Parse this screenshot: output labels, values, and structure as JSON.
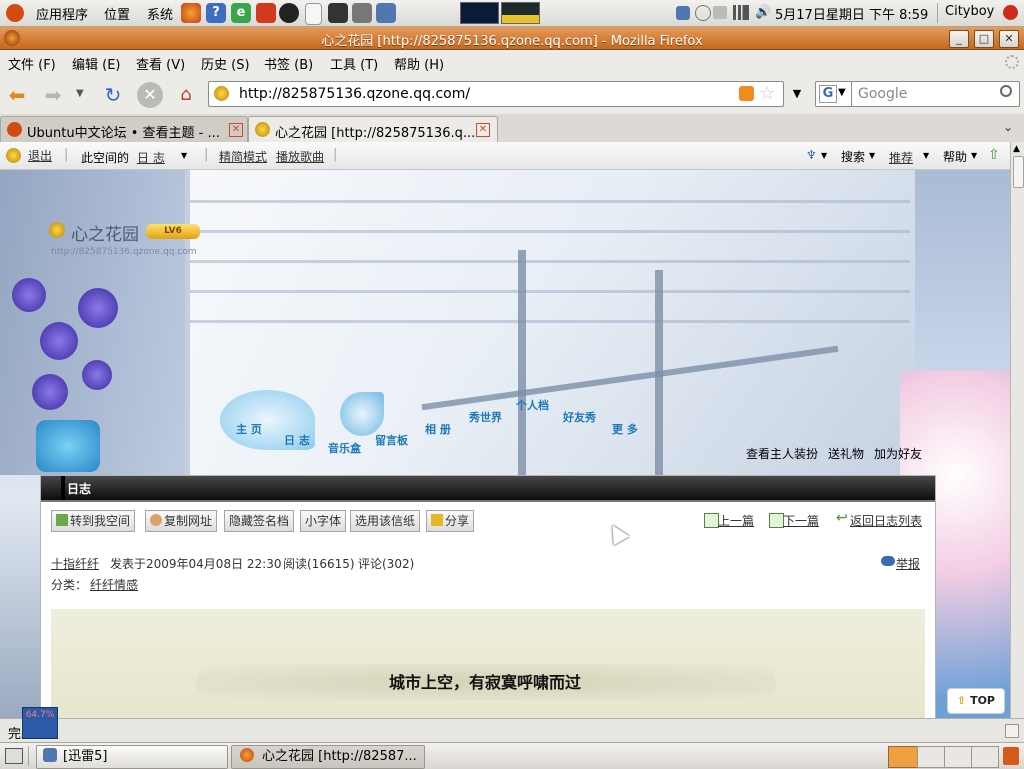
{
  "top_panel": {
    "menus": [
      "应用程序",
      "位置",
      "系统"
    ],
    "clock": "5月17日星期日 下午 8:59",
    "user": "Cityboy"
  },
  "window": {
    "title": "心之花园 [http://825875136.qzone.qq.com] - Mozilla Firefox"
  },
  "menubar": [
    "文件 (F)",
    "编辑 (E)",
    "查看 (V)",
    "历史 (S)",
    "书签 (B)",
    "工具 (T)",
    "帮助 (H)"
  ],
  "navbar": {
    "url": "http://825875136.qzone.qq.com/",
    "search_placeholder": "Google"
  },
  "tabs": [
    {
      "label": "Ubuntu中文论坛 • 查看主题 - ...",
      "active": false
    },
    {
      "label": "心之花园 [http://825875136.q...",
      "active": true
    }
  ],
  "qzone_toolbar": {
    "logout": "退出",
    "space_label": "此空间的",
    "space_select": "日 志",
    "simple_mode": "精简模式",
    "play_music": "播放歌曲",
    "search": "搜索",
    "recommend": "推荐",
    "help": "帮助"
  },
  "space": {
    "name": "心之花园",
    "level": "LV6",
    "url": "http://825875136.qzone.qq.com",
    "nav": [
      "主 页",
      "日 志",
      "音乐盒",
      "留言板",
      "相 册",
      "秀世界",
      "个人档",
      "好友秀",
      "更 多"
    ],
    "right_links": [
      "查看主人装扮",
      "送礼物",
      "加为好友"
    ],
    "top_button": "TOP"
  },
  "blog": {
    "header": "日志",
    "buttons": [
      "转到我空间",
      "复制网址",
      "隐藏签名档",
      "小字体",
      "选用该信纸",
      "分享"
    ],
    "prev": "上一篇",
    "next": "下一篇",
    "back": "返回日志列表",
    "author": "十指纤纤",
    "posted_at": "发表于2009年04月08日 22:30",
    "reads": "阅读(16615)",
    "comments": "评论(302)",
    "report": "举报",
    "category_label": "分类：",
    "category": "纤纤情感",
    "title_line": "城市上空，有寂寞呼啸而过"
  },
  "statusbar": {
    "status": "完成",
    "meter": "64.7%"
  },
  "taskbar": [
    {
      "label": "[迅雷5]"
    },
    {
      "label": "心之花园 [http://82587..."
    }
  ]
}
